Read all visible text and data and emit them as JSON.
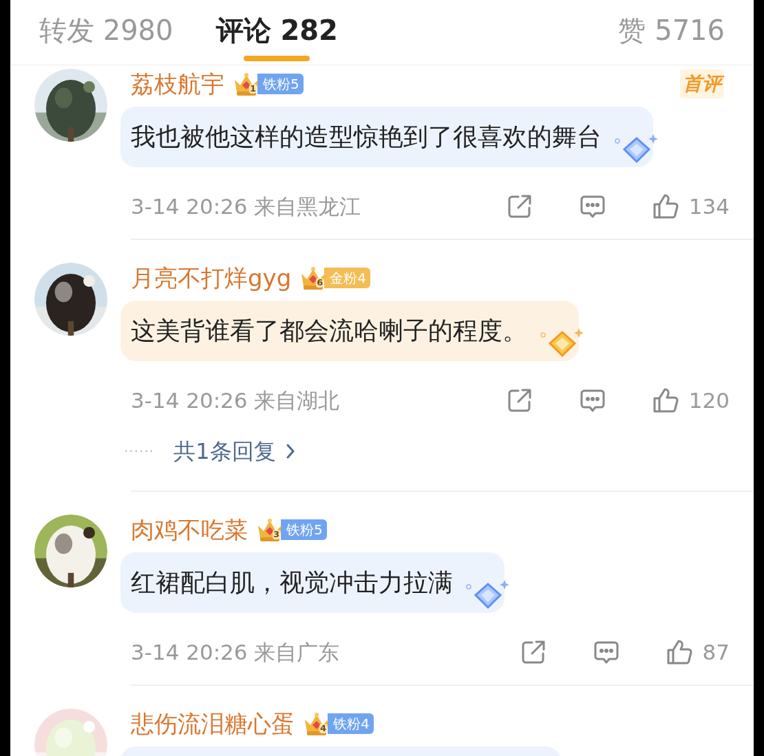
{
  "tabs": [
    {
      "label": "转发 2980",
      "selected": false
    },
    {
      "label": "评论 282",
      "selected": true
    },
    {
      "label": "赞 5716",
      "selected": false
    }
  ],
  "comments": [
    {
      "username": "荔枝航宇",
      "badge": {
        "crown_digit": "1",
        "label": "铁粉5",
        "kind": "iron"
      },
      "tag": "首评",
      "text": "我也被他这样的造型惊艳到了很喜欢的舞台",
      "color": "#edf3fd",
      "time": "3-14 20:26",
      "location": "来自黑龙江",
      "likes": "134"
    },
    {
      "username": "月亮不打烊gyg",
      "badge": {
        "crown_digit": "6",
        "label": "金粉4",
        "kind": "gold"
      },
      "text": "这美背谁看了都会流哈喇子的程度。",
      "color": "#fdf2e2",
      "time": "3-14 20:26",
      "location": "来自湖北",
      "likes": "120",
      "replies": {
        "dots": "······",
        "label": "共1条回复"
      }
    },
    {
      "username": "肉鸡不吃菜",
      "badge": {
        "crown_digit": "3",
        "label": "铁粉5",
        "kind": "iron"
      },
      "text": "红裙配白肌，视觉冲击力拉满",
      "color": "#edf3fd",
      "time": "3-14 20:26",
      "location": "来自广东",
      "likes": "87"
    },
    {
      "username": "悲伤流泪糖心蛋",
      "badge": {
        "crown_digit": "4",
        "label": "铁粉4",
        "kind": "iron"
      },
      "color": "#edf3fd"
    }
  ]
}
